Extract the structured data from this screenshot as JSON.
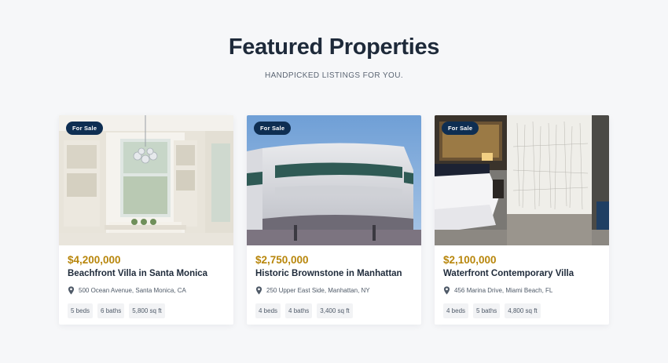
{
  "section": {
    "title": "Featured Properties",
    "subtitle": "HANDPICKED LISTINGS FOR YOU."
  },
  "colors": {
    "badge_bg": "#0e2e52",
    "price": "#b8860b",
    "background": "#f6f7f9"
  },
  "properties": [
    {
      "badge": "For Sale",
      "price": "$4,200,000",
      "title": "Beachfront Villa in Santa Monica",
      "address": "500 Ocean Avenue, Santa Monica, CA",
      "beds": "5 beds",
      "baths": "6 baths",
      "area": "5,800 sq ft",
      "image": "bright-dining-room-with-chandelier"
    },
    {
      "badge": "For Sale",
      "price": "$2,750,000",
      "title": "Historic Brownstone in Manhattan",
      "address": "250 Upper East Side, Manhattan, NY",
      "beds": "4 beds",
      "baths": "4 baths",
      "area": "3,400 sq ft",
      "image": "curved-white-building-blue-sky"
    },
    {
      "badge": "For Sale",
      "price": "$2,100,000",
      "title": "Waterfront Contemporary Villa",
      "address": "456 Marina Drive, Miami Beach, FL",
      "beds": "4 beds",
      "baths": "5 baths",
      "area": "4,800 sq ft",
      "image": "modern-bedroom-interior"
    }
  ]
}
